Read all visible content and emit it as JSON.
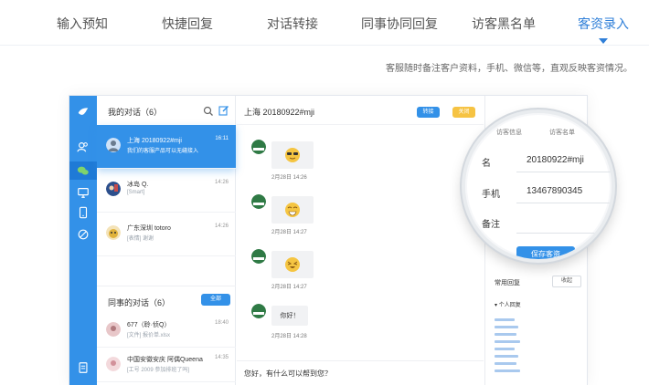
{
  "colors": {
    "accent": "#3391e8",
    "accent_dark": "#1f7ad6",
    "warning": "#f6c343",
    "tab_active": "#2f7fd8"
  },
  "tabs": [
    {
      "label": "输入预知"
    },
    {
      "label": "快捷回复"
    },
    {
      "label": "对话转接"
    },
    {
      "label": "同事协同回复"
    },
    {
      "label": "访客黑名单"
    },
    {
      "label": "客资录入",
      "active": true
    }
  ],
  "tagline": "客服随时备注客户资料，手机、微信等，直观反映客资情况。",
  "rail_icons": [
    "bird-logo-icon",
    "user-group-icon",
    "wechat-icon",
    "monitor-icon",
    "phone-icon",
    "block-icon",
    "document-icon"
  ],
  "my_conversations": {
    "title": "我的对话（6）",
    "items": [
      {
        "name": "上海 20180922#mji",
        "sub": "我们的客服产品可以无缝接入",
        "time": "16:11",
        "active": true
      },
      {
        "name": "冰岛 Q.",
        "sub": "[Smart]",
        "time": "14:26"
      },
      {
        "name": "广东深圳 totoro",
        "sub": "[表情] 谢谢",
        "time": "14:26"
      }
    ]
  },
  "colleague_conversations": {
    "title": "同事的对话（6）",
    "all_button": "全部",
    "items": [
      {
        "name": "677（聆·侦Q）",
        "sub": "[文件] 报价单.xlsx",
        "time": "18:40"
      },
      {
        "name": "中国安徽安庆 阿偶Queena",
        "sub": "[工号 2009 参加排班了吗]",
        "time": "14:35"
      }
    ]
  },
  "chat": {
    "title": "上海 20180922#mji",
    "transfer_label": "转接",
    "end_label": "关闭",
    "messages": [
      {
        "emoji": "sunglasses",
        "time": "2月28日 14:26"
      },
      {
        "emoji": "grin",
        "time": "2月28日 14:27"
      },
      {
        "emoji": "laughing",
        "time": "2月28日 14:27"
      },
      {
        "text": "你好！",
        "time": "2月28日 14:28"
      }
    ],
    "input_text": "您好，有什么可以帮到您？"
  },
  "panel": {
    "tab_left": "访客信息",
    "tab_right": "访客名单",
    "name_label": "名",
    "name_value": "20180922#mji",
    "phone_label": "手机",
    "phone_value": "13467890345",
    "note_label": "备注",
    "save_button": "保存客资",
    "common_reply": "常用回复",
    "close_button": "收起",
    "personal_reply": "个人回复"
  }
}
